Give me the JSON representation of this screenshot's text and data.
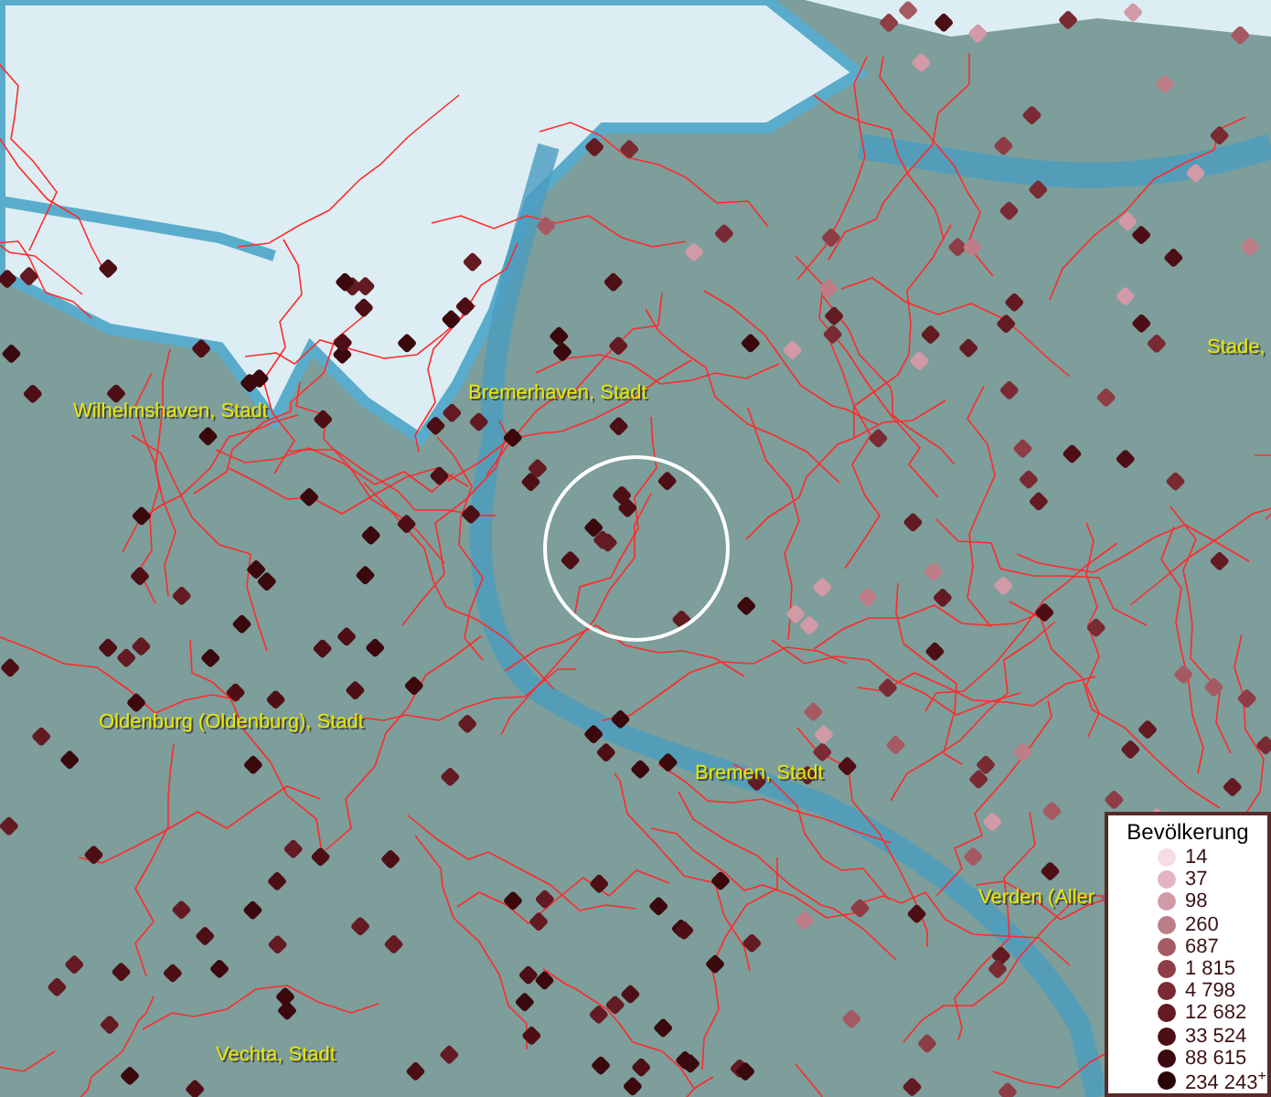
{
  "map_labels": [
    {
      "text": "Wilhelmshaven, Stadt"
    },
    {
      "text": "Bremerhaven, Stadt"
    },
    {
      "text": "Stade,"
    },
    {
      "text": "Oldenburg (Oldenburg), Stadt"
    },
    {
      "text": "Bremen, Stadt"
    },
    {
      "text": "Verden (Aller"
    },
    {
      "text": "Vechta, Stadt"
    }
  ],
  "legend": {
    "title": "Bevölkerung",
    "items": [
      {
        "label": "14",
        "color": "#f4dce8"
      },
      {
        "label": "37",
        "color": "#e3b5c3"
      },
      {
        "label": "98",
        "color": "#d19aa6"
      },
      {
        "label": "260",
        "color": "#bd7d87"
      },
      {
        "label": "687",
        "color": "#a55a63"
      },
      {
        "label": "1 815",
        "color": "#8e3c45"
      },
      {
        "label": "4 798",
        "color": "#7a2a33"
      },
      {
        "label": "12 682",
        "color": "#641a22"
      },
      {
        "label": "33 524",
        "color": "#4d0f15"
      },
      {
        "label": "88 615",
        "color": "#3a080d"
      },
      {
        "label": "234 243$^{+}$",
        "color": "#2a0508"
      }
    ]
  }
}
